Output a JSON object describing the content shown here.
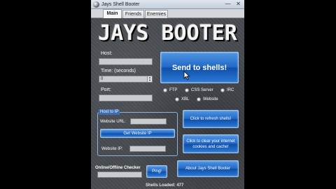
{
  "window": {
    "title": "Jays Shell Booter",
    "minimize": "—",
    "close": "✕"
  },
  "tabs": [
    {
      "label": "Main",
      "active": true
    },
    {
      "label": "Friends",
      "active": false
    },
    {
      "label": "Enemies",
      "active": false
    }
  ],
  "logo": {
    "text": "JAYS BOOTER"
  },
  "form": {
    "host_label": "Host:",
    "host_value": "",
    "time_label": "Time: (seconds)",
    "time_value": "0",
    "port_label": "Port:",
    "port_value": ""
  },
  "send_button": "Send to shells!",
  "radios": [
    {
      "label": "FTP"
    },
    {
      "label": "CSS Server"
    },
    {
      "label": "IRC"
    },
    {
      "label": "XBL"
    },
    {
      "label": "Website"
    }
  ],
  "host_to_ip": {
    "title": "Host to IP",
    "url_label": "Website URL:",
    "url_value": "",
    "get_button": "Get Website IP",
    "ip_label": "Website IP:",
    "ip_value": ""
  },
  "buttons": {
    "refresh": "Click to refresh shells!",
    "clear": "Click to clear your internet cookies and cache!",
    "about": "About Jays Shell Booter"
  },
  "checker": {
    "label": "Online/Offline Checker",
    "value": "",
    "ping_button": "Ping!"
  },
  "status": {
    "text": "Shells Loaded: 477"
  },
  "colors": {
    "accent": "#2369c6",
    "background": "#4a4d52"
  }
}
